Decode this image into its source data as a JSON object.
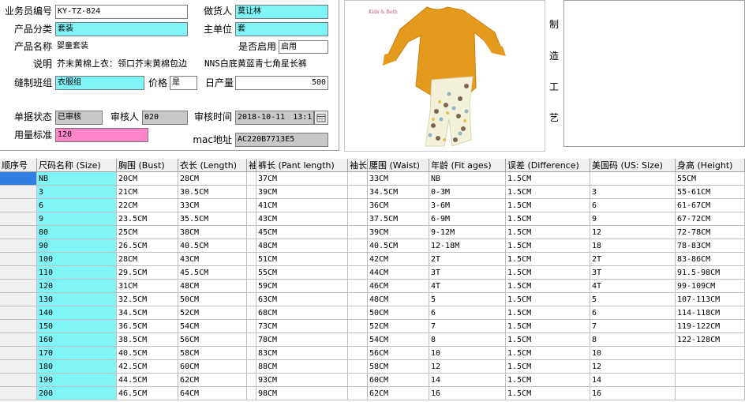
{
  "form": {
    "salesman_no": {
      "label": "业务员编号",
      "value": "KY-TZ-824"
    },
    "maker": {
      "label": "做货人",
      "value": "莫让林"
    },
    "category": {
      "label": "产品分类",
      "value": "套装"
    },
    "main_unit": {
      "label": "主单位",
      "value": "套"
    },
    "product_name": {
      "label": "产品名称",
      "value": "婴童套装"
    },
    "enabled": {
      "label": "是否启用",
      "value": "启用"
    },
    "description": {
      "label": "说明",
      "value": "芥末黄棉上衣：领口芥末黄棉包边　　NNS白底黄蓝青七角星长裤"
    },
    "sewing_team": {
      "label": "缝制班组",
      "value": "衣服组"
    },
    "price": {
      "label": "价格",
      "value": "是"
    },
    "daily_output": {
      "label": "日产量",
      "value": "500"
    },
    "doc_status": {
      "label": "单据状态",
      "value": "已审核"
    },
    "auditor": {
      "label": "审核人",
      "value": "020"
    },
    "audit_time": {
      "label": "审核时间",
      "value": "2018-10-11　13:1"
    },
    "usage_std": {
      "label": "用量标准",
      "value": "120"
    },
    "mac": {
      "label": "mac地址",
      "value": "AC220B7713E5"
    }
  },
  "craft": {
    "chars": [
      "制",
      "造",
      "工",
      "艺"
    ]
  },
  "photo": {
    "brand_text": "Kids & Beth"
  },
  "table": {
    "headers": [
      "顺序号",
      "尺码名称 (Size)",
      "胸围 (Bust)",
      "衣长 (Length)",
      "袖",
      "裤长 (Pant length)",
      "袖长",
      "腰围 (Waist)",
      "年龄 (Fit ages)",
      "误差 (Difference)",
      "美国码 (US: Size)",
      "身高 (Height)"
    ],
    "rows": [
      [
        "",
        "NB",
        "20CM",
        "28CM",
        "",
        "37CM",
        "",
        "33CM",
        "NB",
        "1.5CM",
        "",
        "55CM"
      ],
      [
        "",
        "3",
        "21CM",
        "30.5CM",
        "",
        "39CM",
        "",
        "34.5CM",
        "0-3M",
        "1.5CM",
        "3",
        "55-61CM"
      ],
      [
        "",
        "6",
        "22CM",
        "33CM",
        "",
        "41CM",
        "",
        "36CM",
        "3-6M",
        "1.5CM",
        "6",
        "61-67CM"
      ],
      [
        "",
        "9",
        "23.5CM",
        "35.5CM",
        "",
        "43CM",
        "",
        "37.5CM",
        "6-9M",
        "1.5CM",
        "9",
        "67-72CM"
      ],
      [
        "",
        "80",
        "25CM",
        "38CM",
        "",
        "45CM",
        "",
        "39CM",
        "9-12M",
        "1.5CM",
        "12",
        "72-78CM"
      ],
      [
        "",
        "90",
        "26.5CM",
        "40.5CM",
        "",
        "48CM",
        "",
        "40.5CM",
        "12-18M",
        "1.5CM",
        "18",
        "78-83CM"
      ],
      [
        "",
        "100",
        "28CM",
        "43CM",
        "",
        "51CM",
        "",
        "42CM",
        "2T",
        "1.5CM",
        "2T",
        "83-86CM"
      ],
      [
        "",
        "110",
        "29.5CM",
        "45.5CM",
        "",
        "55CM",
        "",
        "44CM",
        "3T",
        "1.5CM",
        "3T",
        "91.5-98CM"
      ],
      [
        "",
        "120",
        "31CM",
        "48CM",
        "",
        "59CM",
        "",
        "46CM",
        "4T",
        "1.5CM",
        "4T",
        "99-109CM"
      ],
      [
        "",
        "130",
        "32.5CM",
        "50CM",
        "",
        "63CM",
        "",
        "48CM",
        "5",
        "1.5CM",
        "5",
        "107-113CM"
      ],
      [
        "",
        "140",
        "34.5CM",
        "52CM",
        "",
        "68CM",
        "",
        "50CM",
        "6",
        "1.5CM",
        "6",
        "114-118CM"
      ],
      [
        "",
        "150",
        "36.5CM",
        "54CM",
        "",
        "73CM",
        "",
        "52CM",
        "7",
        "1.5CM",
        "7",
        "119-122CM"
      ],
      [
        "",
        "160",
        "38.5CM",
        "56CM",
        "",
        "78CM",
        "",
        "54CM",
        "8",
        "1.5CM",
        "8",
        "122-128CM"
      ],
      [
        "",
        "170",
        "40.5CM",
        "58CM",
        "",
        "83CM",
        "",
        "56CM",
        "10",
        "1.5CM",
        "10",
        ""
      ],
      [
        "",
        "180",
        "42.5CM",
        "60CM",
        "",
        "88CM",
        "",
        "58CM",
        "12",
        "1.5CM",
        "12",
        ""
      ],
      [
        "",
        "190",
        "44.5CM",
        "62CM",
        "",
        "93CM",
        "",
        "60CM",
        "14",
        "1.5CM",
        "14",
        ""
      ],
      [
        "",
        "200",
        "46.5CM",
        "64CM",
        "",
        "98CM",
        "",
        "62CM",
        "16",
        "1.5CM",
        "16",
        ""
      ]
    ]
  }
}
